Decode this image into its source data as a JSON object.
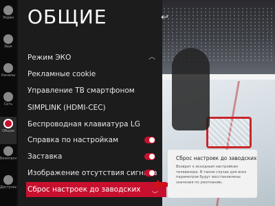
{
  "sidebar": {
    "items": [
      {
        "label": "Экран",
        "icon": "screen-icon"
      },
      {
        "label": "Звук",
        "icon": "sound-icon"
      },
      {
        "label": "Каналы",
        "icon": "channels-icon"
      },
      {
        "label": "Сеть",
        "icon": "network-icon"
      },
      {
        "label": "Общие",
        "icon": "general-icon"
      },
      {
        "label": "Безопасность",
        "icon": "lock-icon"
      },
      {
        "label": "Доступность",
        "icon": "accessibility-icon"
      }
    ]
  },
  "panel": {
    "title": "ОБЩИЕ",
    "back_icon": "back-icon",
    "items": [
      {
        "label": "Режим ЭКО"
      },
      {
        "label": "Рекламные cookie"
      },
      {
        "label": "Управление ТВ смартфоном"
      },
      {
        "label": "SIMPLINK (HDMI-CEC)"
      },
      {
        "label": "Беспроводная клавиатура LG"
      },
      {
        "label": "Справка по настройкам"
      },
      {
        "label": "Заставка"
      },
      {
        "label": "Изображение отсутствия сигнала"
      },
      {
        "label": "Сброс настроек до заводских"
      }
    ]
  },
  "tooltip": {
    "title": "Сброс настроек до заводских",
    "text": "Возврат к исходным настройкам телевизора. В таком случае для всех параметров будут восстановлены значения по умолчанию."
  },
  "colors": {
    "accent": "#c8102e",
    "panel_bg": "#1c1c1c"
  }
}
